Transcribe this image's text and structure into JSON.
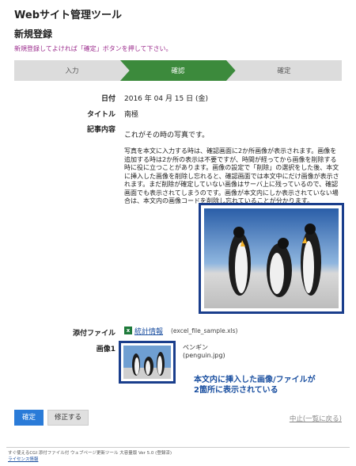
{
  "header": {
    "app_title": "Webサイト管理ツール",
    "page_title": "新規登録",
    "instruction": "新規登録してよければ「確定」ボタンを押して下さい。"
  },
  "steps": [
    "入力",
    "確認",
    "確定"
  ],
  "active_step": 1,
  "fields": {
    "date_label": "日付",
    "date_value": "2016 年 04 月 15 日 (金)",
    "title_label": "タイトル",
    "title_value": "南極",
    "content_label": "記事内容",
    "content_first_line": "これがその時の写真です。",
    "content_body": "写真を本文に入力する時は、確認画面に2か所画像が表示されます。画像を追加する時は2か所の表示は不要ですが、時間が経ってから画像を削除する時に役に立つことがあります。画像の設定で「削除」の選択をした後、本文に挿入した画像を削除し忘れると、確認画面では本文中にだけ画像が表示されます。まだ削除が確定していない画像はサーバ上に残っているので、確認画面でも表示されてしまうのです。画像が本文内にしか表示されていない場合は、本文内の画像コードを削除し忘れていることが分かります。",
    "attach_label": "添付ファイル",
    "attach_link": "統計情報",
    "attach_file": "(excel_file_sample.xls)",
    "image_label": "画像1",
    "image_name": "ペンギン",
    "image_file": "(penguin.jpg)"
  },
  "note": {
    "line1": "本文内に挿入した画像/ファイルが",
    "line2": "2箇所に表示されている"
  },
  "buttons": {
    "confirm": "確定",
    "edit": "修正する",
    "cancel": "中止(一覧に戻る)"
  },
  "footer": {
    "text": "すぐ使えるCGI 添付ファイル付 ウェブページ更新ツール 大容量版 Ver 5.0 (登録済)",
    "link": "ライセンス情報"
  },
  "colors": {
    "active_step": "#3c8a3c",
    "frame": "#1a3e8c",
    "instruction": "#9b2b8c",
    "primary_button": "#2a7bd8"
  }
}
